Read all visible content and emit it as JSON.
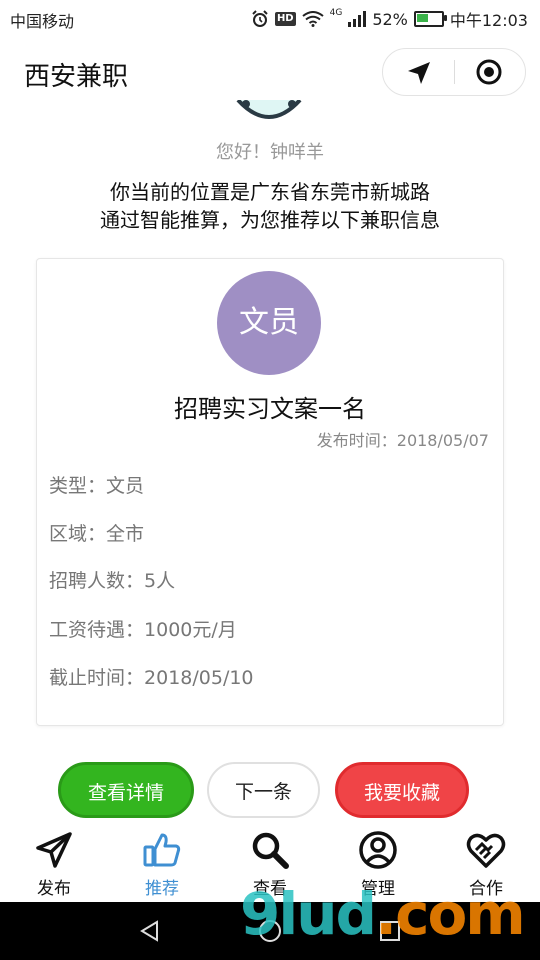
{
  "status_bar": {
    "carrier": "中国移动",
    "battery": "52%",
    "battery_level": 0.52,
    "time": "中午12:03",
    "net": "4G",
    "hd": "HD"
  },
  "navbar": {
    "title": "西安兼职"
  },
  "greeting": "您好！钟咩羊",
  "location_line1": "你当前的位置是广东省东莞市新城路",
  "location_line2": "通过智能推算，为您推荐以下兼职信息",
  "card": {
    "badge": "文员",
    "badge_color": "#9f8fc4",
    "title": "招聘实习文案一名",
    "publish_time": "发布时间：2018/05/07",
    "details": [
      {
        "label": "类型：",
        "value": "文员"
      },
      {
        "label": "区域：",
        "value": "全市"
      },
      {
        "label": "招聘人数：",
        "value": "5人"
      },
      {
        "label": "工资待遇：",
        "value": "1000元/月"
      },
      {
        "label": "截止时间：",
        "value": "2018/05/10"
      }
    ]
  },
  "actions": {
    "detail": "查看详情",
    "next": "下一条",
    "favorite": "我要收藏"
  },
  "tabs": [
    {
      "label": "发布",
      "icon": "send-icon",
      "active": false
    },
    {
      "label": "推荐",
      "icon": "thumbs-up-icon",
      "active": true
    },
    {
      "label": "查看",
      "icon": "search-icon",
      "active": false
    },
    {
      "label": "管理",
      "icon": "user-circle-icon",
      "active": false
    },
    {
      "label": "合作",
      "icon": "handshake-icon",
      "active": false
    }
  ],
  "colors": {
    "accent": "#3f8fd2",
    "green_button": "#33b51f",
    "red_button": "#f04447"
  },
  "watermark": {
    "brand": "9lud",
    "suffix": ".com"
  }
}
